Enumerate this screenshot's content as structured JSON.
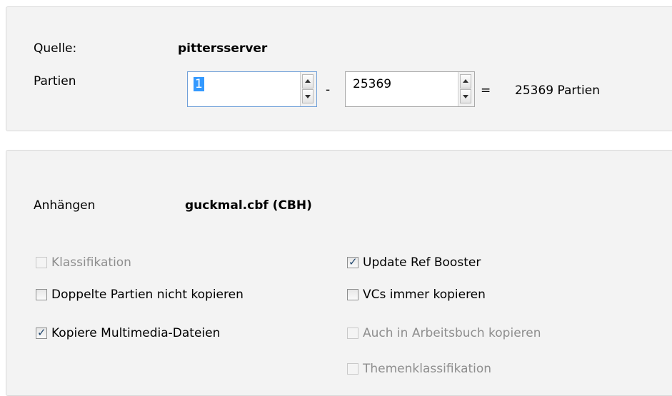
{
  "source": {
    "label": "Quelle:",
    "value": "pittersserver"
  },
  "range": {
    "label": "Partien",
    "from": "1",
    "dash": "-",
    "to": "25369",
    "equals": "=",
    "result": "25369 Partien"
  },
  "append": {
    "label": "Anhängen",
    "value": "guckmal.cbf (CBH)"
  },
  "options": {
    "klassifikation": {
      "label": "Klassifikation",
      "checked": false,
      "enabled": false
    },
    "doppelte": {
      "label": "Doppelte Partien nicht kopieren",
      "checked": false,
      "enabled": true
    },
    "multimedia": {
      "label": "Kopiere Multimedia-Dateien",
      "checked": true,
      "enabled": true
    },
    "refbooster": {
      "label": "Update Ref Booster",
      "checked": true,
      "enabled": true
    },
    "vcs": {
      "label": "VCs immer kopieren",
      "checked": false,
      "enabled": true
    },
    "arbeitsbuch": {
      "label": "Auch in Arbeitsbuch kopieren",
      "checked": false,
      "enabled": false
    },
    "themen": {
      "label": "Themenklassifikation",
      "checked": false,
      "enabled": false
    }
  }
}
